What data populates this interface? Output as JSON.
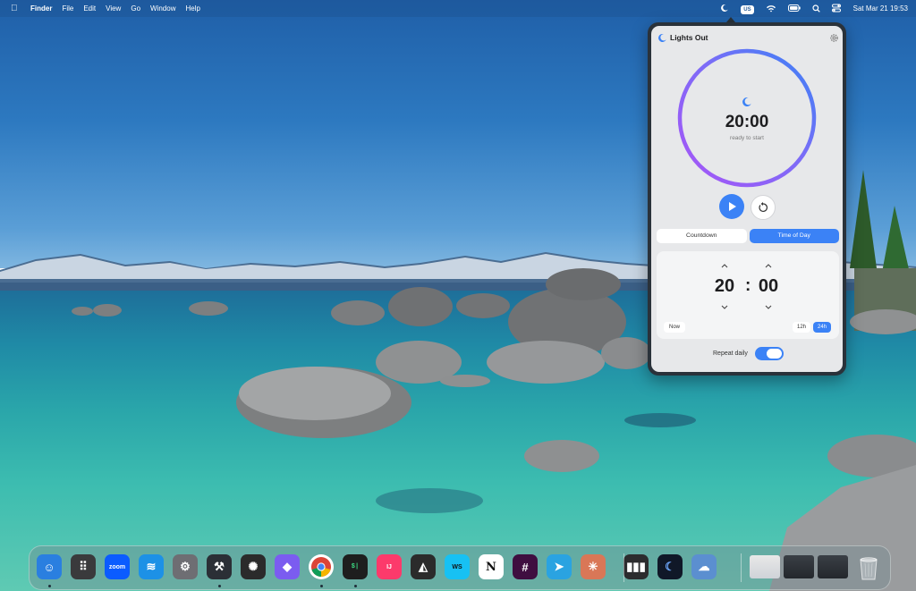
{
  "menubar": {
    "app_name": "Finder",
    "menus": [
      "File",
      "Edit",
      "View",
      "Go",
      "Window",
      "Help"
    ],
    "keyboard_layout": "US",
    "datetime": "Sat Mar 21  19:53"
  },
  "popover": {
    "title": "Lights Out",
    "time_display": "20:00",
    "status": "ready to start",
    "ring_progress": 1.0,
    "modes": [
      "Countdown",
      "Time of Day"
    ],
    "active_mode": "Time of Day",
    "hour": "20",
    "minute": "00",
    "separator": ":",
    "now_label": "Now",
    "format_12h": "12h",
    "format_24h": "24h",
    "active_format": "24h",
    "repeat_label": "Repeat daily",
    "repeat_enabled": true
  },
  "dock": {
    "apps": [
      {
        "name": "finder-icon",
        "label": "",
        "color": "#2a7fe0",
        "running": true
      },
      {
        "name": "launchpad-icon",
        "label": "",
        "color": "#3a3a3c",
        "running": false
      },
      {
        "name": "zoom-icon",
        "label": "zoom",
        "color": "#0b5cff",
        "running": false
      },
      {
        "name": "docker-icon",
        "label": "",
        "color": "#1d91e6",
        "running": false
      },
      {
        "name": "system-settings-icon",
        "label": "",
        "color": "#6e6e73",
        "running": false
      },
      {
        "name": "xcode-tools-icon",
        "label": "",
        "color": "#2b2f36",
        "running": true
      },
      {
        "name": "chatgpt-icon",
        "label": "",
        "color": "#2b2b2b",
        "running": false
      },
      {
        "name": "linear-icon",
        "label": "",
        "color": "#7b5cf0",
        "running": false
      },
      {
        "name": "chrome-icon",
        "label": "",
        "color": "#ffffff",
        "running": true
      },
      {
        "name": "terminal-icon",
        "label": "$|",
        "color": "#1e1e1e",
        "running": true
      },
      {
        "name": "intellij-icon",
        "label": "IJ",
        "color": "#fc3a6b",
        "running": false
      },
      {
        "name": "cursor-icon",
        "label": "",
        "color": "#2b2b2b",
        "running": false
      },
      {
        "name": "webstorm-icon",
        "label": "WS",
        "color": "#17c1f3",
        "running": false
      },
      {
        "name": "notion-icon",
        "label": "N",
        "color": "#ffffff",
        "running": false
      },
      {
        "name": "slack-icon",
        "label": "",
        "color": "#3f0e40",
        "running": false
      },
      {
        "name": "telegram-icon",
        "label": "",
        "color": "#2aa3e1",
        "running": false
      },
      {
        "name": "claude-icon",
        "label": "",
        "color": "#d97757",
        "running": false
      },
      {
        "name": "istat-menus-icon",
        "label": "",
        "color": "#2c2c2e",
        "running": false
      },
      {
        "name": "lights-out-icon",
        "label": "",
        "color": "#101828",
        "running": false
      },
      {
        "name": "weather-icon",
        "label": "",
        "color": "#5b8fd0",
        "running": false
      }
    ],
    "minimized": [
      {
        "name": "minimized-window-chrome"
      },
      {
        "name": "minimized-window-xcode"
      },
      {
        "name": "minimized-window-xcode-2"
      }
    ]
  },
  "colors": {
    "accent": "#3b82f6",
    "ring_gradient_start": "#a855f7",
    "ring_gradient_end": "#3b82f6"
  }
}
